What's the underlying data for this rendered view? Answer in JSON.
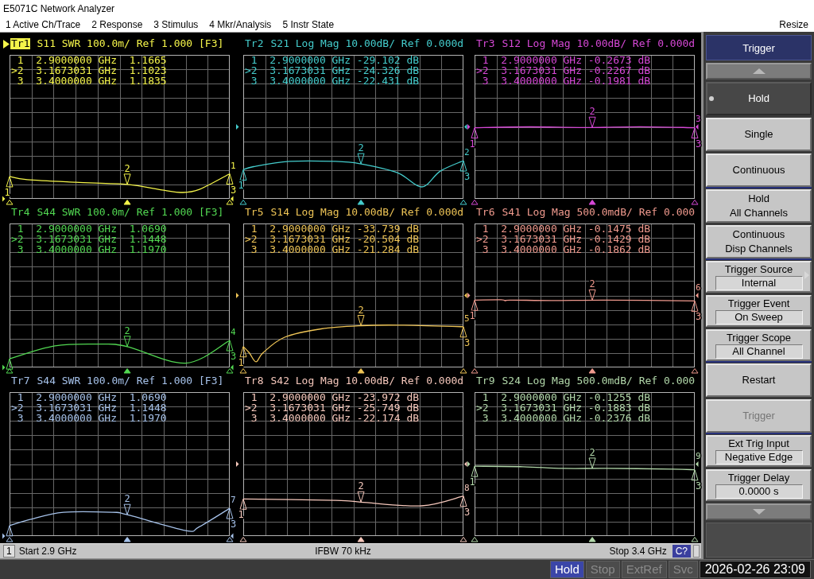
{
  "window": {
    "title": "E5071C Network Analyzer"
  },
  "menu": {
    "items": [
      "1 Active Ch/Trace",
      "2 Response",
      "3 Stimulus",
      "4 Mkr/Analysis",
      "5 Instr State"
    ],
    "resize": "Resize"
  },
  "traces": [
    {
      "name": "Tr1",
      "settings": "S11 SWR 100.0m/ Ref 1.000 [F3]",
      "kind": "swr",
      "selected": true,
      "color": "#f4f44a",
      "end_label": "1",
      "markers": [
        {
          "number": "1",
          "readout": "1",
          "stimulus": "2.9000000 GHz",
          "value": "1.1665",
          "selected": false
        },
        {
          "number": "2",
          "readout": ">2",
          "stimulus": "3.1673031 GHz",
          "value": "1.1023",
          "selected": true
        },
        {
          "number": "3",
          "readout": "3",
          "stimulus": "3.4000000 GHz",
          "value": "1.1835",
          "selected": false
        }
      ]
    },
    {
      "name": "Tr2",
      "settings": "S21 Log Mag 10.00dB/ Ref 0.000d",
      "kind": "log_mag",
      "selected": false,
      "color": "#44cccc",
      "end_label": "2",
      "markers": [
        {
          "number": "1",
          "readout": "1",
          "stimulus": "2.9000000 GHz",
          "value": "-29.102",
          "unit": "dB",
          "selected": false
        },
        {
          "number": "2",
          "readout": ">2",
          "stimulus": "3.1673031 GHz",
          "value": "-24.326",
          "unit": "dB",
          "selected": true
        },
        {
          "number": "3",
          "readout": "3",
          "stimulus": "3.4000000 GHz",
          "value": "-22.431",
          "unit": "dB",
          "selected": false
        }
      ]
    },
    {
      "name": "Tr3",
      "settings": "S12 Log Mag 10.00dB/ Ref 0.000d",
      "kind": "log_mag",
      "selected": false,
      "color": "#d648d6",
      "end_label": "3",
      "markers": [
        {
          "number": "1",
          "readout": "1",
          "stimulus": "2.9000000 GHz",
          "value": "-0.2673",
          "unit": "dB",
          "selected": false
        },
        {
          "number": "2",
          "readout": ">2",
          "stimulus": "3.1673031 GHz",
          "value": "-0.2267",
          "unit": "dB",
          "selected": true
        },
        {
          "number": "3",
          "readout": "3",
          "stimulus": "3.4000000 GHz",
          "value": "-0.1981",
          "unit": "dB",
          "selected": false
        }
      ]
    },
    {
      "name": "Tr4",
      "settings": "S44 SWR 100.0m/ Ref 1.000 [F3]",
      "kind": "swr",
      "selected": false,
      "color": "#52d852",
      "end_label": "4",
      "markers": [
        {
          "readout": "1",
          "stimulus": "2.9000000 GHz",
          "value": "1.0690",
          "selected": false
        },
        {
          "number": "2",
          "readout": ">2",
          "stimulus": "3.1673031 GHz",
          "value": "1.1448",
          "selected": true
        },
        {
          "number": "3",
          "readout": "3",
          "stimulus": "3.4000000 GHz",
          "value": "1.1970",
          "selected": false
        }
      ]
    },
    {
      "name": "Tr5",
      "settings": "S14 Log Mag 10.00dB/ Ref 0.000d",
      "kind": "log_mag",
      "selected": false,
      "color": "#eec456",
      "end_label": "5",
      "markers": [
        {
          "number": "1",
          "readout": "1",
          "stimulus": "2.9000000 GHz",
          "value": "-33.739",
          "unit": "dB",
          "selected": false
        },
        {
          "number": "2",
          "readout": ">2",
          "stimulus": "3.1673031 GHz",
          "value": "-20.504",
          "unit": "dB",
          "selected": true
        },
        {
          "number": "3",
          "readout": "3",
          "stimulus": "3.4000000 GHz",
          "value": "-21.284",
          "unit": "dB",
          "selected": false
        }
      ]
    },
    {
      "name": "Tr6",
      "settings": "S41 Log Mag 500.0mdB/ Ref 0.000",
      "kind": "log_mag",
      "selected": false,
      "color": "#f09a8e",
      "end_label": "6",
      "markers": [
        {
          "number": "1",
          "readout": "1",
          "stimulus": "2.9000000 GHz",
          "value": "-0.1475",
          "unit": "dB",
          "selected": false
        },
        {
          "number": "2",
          "readout": ">2",
          "stimulus": "3.1673031 GHz",
          "value": "-0.1429",
          "unit": "dB",
          "selected": true
        },
        {
          "number": "3",
          "readout": "3",
          "stimulus": "3.4000000 GHz",
          "value": "-0.1862",
          "unit": "dB",
          "selected": false
        }
      ]
    },
    {
      "name": "Tr7",
      "settings": "S44 SWR 100.0m/ Ref 1.000 [F3]",
      "kind": "swr",
      "selected": false,
      "color": "#a6c2ea",
      "end_label": "7",
      "markers": [
        {
          "readout": "1",
          "stimulus": "2.9000000 GHz",
          "value": "1.0690",
          "selected": false
        },
        {
          "number": "2",
          "readout": ">2",
          "stimulus": "3.1673031 GHz",
          "value": "1.1448",
          "selected": true
        },
        {
          "number": "3",
          "readout": "3",
          "stimulus": "3.4000000 GHz",
          "value": "1.1970",
          "selected": false
        }
      ]
    },
    {
      "name": "Tr8",
      "settings": "S42 Log Mag 10.00dB/ Ref 0.000d",
      "kind": "log_mag",
      "selected": false,
      "color": "#f6c8bc",
      "end_label": "8",
      "markers": [
        {
          "number": "1",
          "readout": "1",
          "stimulus": "2.9000000 GHz",
          "value": "-23.972",
          "unit": "dB",
          "selected": false
        },
        {
          "number": "2",
          "readout": ">2",
          "stimulus": "3.1673031 GHz",
          "value": "-25.749",
          "unit": "dB",
          "selected": true
        },
        {
          "number": "3",
          "readout": "3",
          "stimulus": "3.4000000 GHz",
          "value": "-22.174",
          "unit": "dB",
          "selected": false
        }
      ]
    },
    {
      "name": "Tr9",
      "settings": "S24 Log Mag 500.0mdB/ Ref 0.000",
      "kind": "log_mag",
      "selected": false,
      "color": "#b2d8aa",
      "end_label": "9",
      "markers": [
        {
          "number": "1",
          "readout": "1",
          "stimulus": "2.9000000 GHz",
          "value": "-0.1255",
          "unit": "dB",
          "selected": false
        },
        {
          "number": "2",
          "readout": ">2",
          "stimulus": "3.1673031 GHz",
          "value": "-0.1883",
          "unit": "dB",
          "selected": true
        },
        {
          "number": "3",
          "readout": "3",
          "stimulus": "3.4000000 GHz",
          "value": "-0.2376",
          "unit": "dB",
          "selected": false
        }
      ]
    }
  ],
  "channel_bar": {
    "channel": "1",
    "start": "Start 2.9 GHz",
    "ifbw": "IFBW 70 kHz",
    "stop": "Stop 3.4 GHz",
    "badge": "C?"
  },
  "softkeys": {
    "title": "Trigger",
    "groups": [
      [
        {
          "kind": "scroll_up"
        },
        {
          "kind": "radio",
          "label": "Hold",
          "selected": true
        },
        {
          "kind": "radio",
          "label": "Single",
          "selected": false
        },
        {
          "kind": "radio",
          "label": "Continuous",
          "selected": false
        }
      ],
      [
        {
          "kind": "action",
          "label": "Hold\nAll Channels",
          "disabled": false
        },
        {
          "kind": "action",
          "label": "Continuous\nDisp Channels",
          "disabled": false
        }
      ],
      [
        {
          "kind": "value",
          "label": "Trigger Source",
          "value": "Internal",
          "submenu": true
        },
        {
          "kind": "value",
          "label": "Trigger Event",
          "value": "On Sweep",
          "submenu": false
        },
        {
          "kind": "value",
          "label": "Trigger Scope",
          "value": "All Channel",
          "submenu": false
        }
      ],
      [
        {
          "kind": "action",
          "label": "Restart",
          "disabled": false
        },
        {
          "kind": "action",
          "label": "Trigger",
          "disabled": true
        }
      ],
      [
        {
          "kind": "value",
          "label": "Ext Trig Input",
          "value": "Negative Edge",
          "submenu": false
        },
        {
          "kind": "value",
          "label": "Trigger Delay",
          "value": "0.0000 s",
          "submenu": false
        },
        {
          "kind": "scroll_down"
        }
      ]
    ]
  },
  "status_bar": {
    "indicators": [
      {
        "label": "Hold",
        "on": true
      },
      {
        "label": "Stop",
        "on": false
      },
      {
        "label": "ExtRef",
        "on": false
      },
      {
        "label": "Svc",
        "on": false
      }
    ],
    "datetime": "2026-02-26 23:09"
  }
}
